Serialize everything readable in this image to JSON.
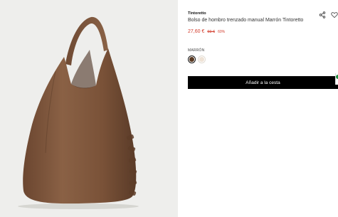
{
  "product": {
    "brand": "Tintoretto",
    "title": "Bolso de hombro trenzado manual Marrón Tintoretto",
    "price_current": "27,60 €",
    "price_original": "69 €",
    "discount": "60%"
  },
  "color": {
    "label": "MARRÓN",
    "options": [
      "#5a3a22",
      "#efe3d6"
    ]
  },
  "actions": {
    "add_to_cart": "Añadir a la cesta"
  },
  "icons": {
    "share": "share-icon",
    "favorite": "heart-icon"
  },
  "colors": {
    "accent_red": "#d23a2a",
    "bag_brown": "#7a5438",
    "button_bg": "#000000"
  }
}
